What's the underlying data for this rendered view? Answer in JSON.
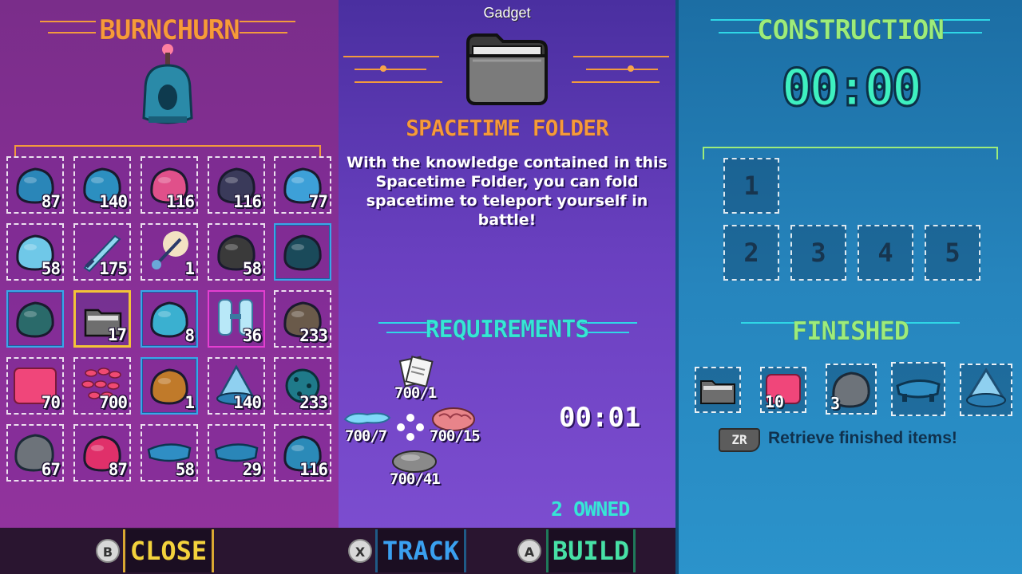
{
  "left": {
    "title": "BURNCHURN",
    "grid": [
      {
        "count": "87",
        "icon": "blue-armor-icon",
        "style": "normal"
      },
      {
        "count": "140",
        "icon": "blue-shoulder-icon",
        "style": "normal"
      },
      {
        "count": "116",
        "icon": "flame-torch-icon",
        "style": "normal"
      },
      {
        "count": "116",
        "icon": "gauntlet-icon",
        "style": "normal"
      },
      {
        "count": "77",
        "icon": "blaster-icon",
        "style": "normal"
      },
      {
        "count": "58",
        "icon": "crystal-axe-icon",
        "style": "normal"
      },
      {
        "count": "175",
        "icon": "dagger-icon",
        "style": "normal"
      },
      {
        "count": "1",
        "icon": "glowing-staff-icon",
        "style": "normal"
      },
      {
        "count": "58",
        "icon": "boots-icon",
        "style": "normal"
      },
      {
        "count": "",
        "icon": "dark-container-icon",
        "style": "blue"
      },
      {
        "count": "",
        "icon": "throne-icon",
        "style": "blue"
      },
      {
        "count": "17",
        "icon": "folder-icon",
        "style": "sel"
      },
      {
        "count": "8",
        "icon": "mystic-idol-icon",
        "style": "blue"
      },
      {
        "count": "36",
        "icon": "ice-crystals-icon",
        "style": "pink"
      },
      {
        "count": "233",
        "icon": "stone-pillar-icon",
        "style": "normal"
      },
      {
        "count": "70",
        "icon": "pink-flesh-icon",
        "style": "normal"
      },
      {
        "count": "700",
        "icon": "pink-scales-icon",
        "style": "normal"
      },
      {
        "count": "1",
        "icon": "amber-shard-icon",
        "style": "blue"
      },
      {
        "count": "140",
        "icon": "crystal-pile-icon",
        "style": "normal"
      },
      {
        "count": "233",
        "icon": "spiked-ball-icon",
        "style": "normal"
      },
      {
        "count": "67",
        "icon": "grey-rock-icon",
        "style": "normal"
      },
      {
        "count": "87",
        "icon": "pink-core-icon",
        "style": "normal"
      },
      {
        "count": "58",
        "icon": "blue-slab-icon",
        "style": "normal"
      },
      {
        "count": "29",
        "icon": "blue-disc-icon",
        "style": "normal"
      },
      {
        "count": "116",
        "icon": "blue-creature-icon",
        "style": "normal"
      }
    ]
  },
  "center": {
    "category": "Gadget",
    "item_name": "SPACETIME FOLDER",
    "description": "With the knowledge contained in this Spacetime Folder, you can fold spacetime to teleport yourself in battle!",
    "requirements_title": "REQUIREMENTS",
    "requirements": [
      {
        "label": "700/1",
        "icon": "papers-icon"
      },
      {
        "label": "700/7",
        "icon": "blue-slime-icon"
      },
      {
        "label": "700/15",
        "icon": "brain-icon"
      },
      {
        "label": "700/41",
        "icon": "grey-stone-icon"
      }
    ],
    "build_time": "00:01",
    "owned": "2 OWNED"
  },
  "right": {
    "title": "CONSTRUCTION",
    "timer": "00:00",
    "slots": [
      "1",
      "2",
      "3",
      "4",
      "5"
    ],
    "finished_title": "FINISHED",
    "finished": [
      {
        "count": "",
        "icon": "folder-icon"
      },
      {
        "count": "10",
        "icon": "pink-flesh-icon"
      },
      {
        "count": "3",
        "icon": "grey-rock-icon"
      },
      {
        "count": "",
        "icon": "blue-slab-icon"
      },
      {
        "count": "",
        "icon": "crystal-pile-icon"
      }
    ],
    "retrieve_key": "ZR",
    "retrieve_text": "Retrieve finished items!"
  },
  "buttons": {
    "close": {
      "key": "B",
      "label": "CLOSE"
    },
    "track": {
      "key": "X",
      "label": "TRACK"
    },
    "build": {
      "key": "A",
      "label": "BUILD"
    }
  },
  "colors": {
    "title_orange": "#f79a3a",
    "title_green": "#9dec7a",
    "title_cyan": "#36e6d6",
    "close_yellow": "#f3d23c",
    "track_blue": "#3aa0f0",
    "build_green": "#47e0a6"
  }
}
